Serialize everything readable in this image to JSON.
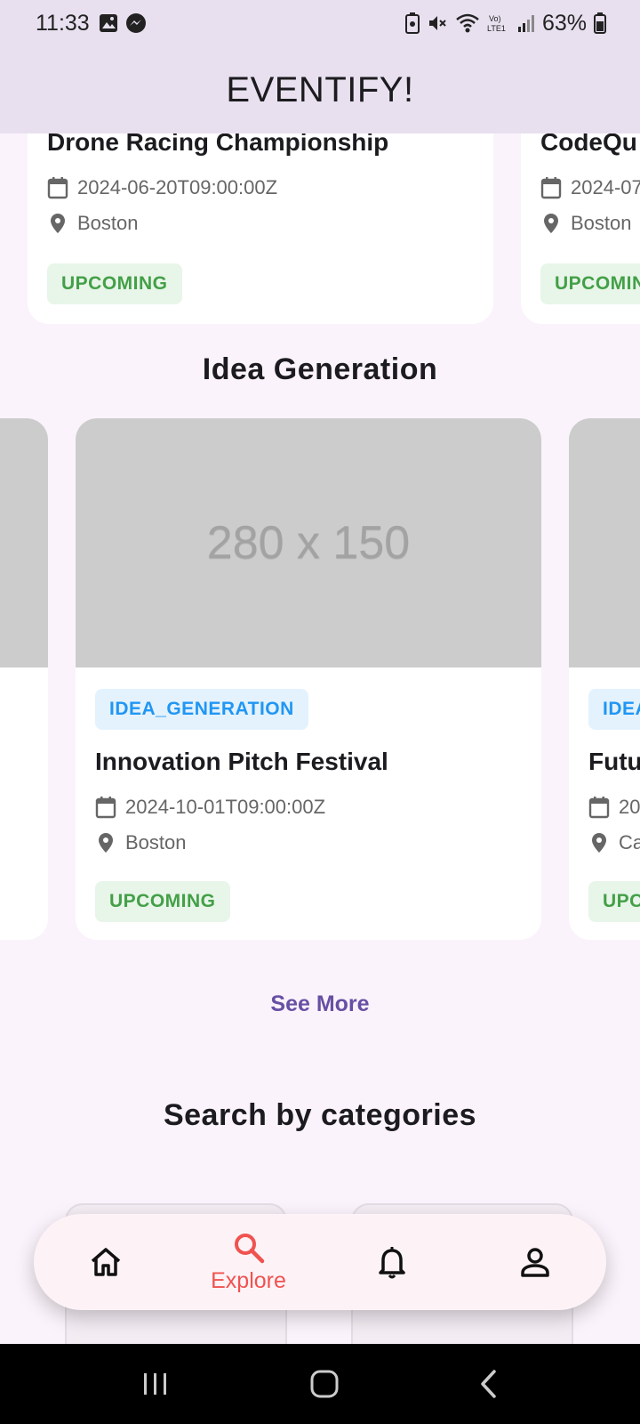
{
  "status_bar": {
    "time": "11:33",
    "battery": "63%"
  },
  "app_title": "EVENTIFY!",
  "top_cards": [
    {
      "title": "Drone Racing Championship",
      "date": "2024-06-20T09:00:00Z",
      "location": "Boston",
      "status": "UPCOMING"
    },
    {
      "title": "CodeQu",
      "date": "2024-07",
      "location": "Boston",
      "status": "UPCOMIN"
    }
  ],
  "idea_section": {
    "title": "Idea Generation",
    "cards": [
      {
        "image_text": "280 x 150",
        "category": "IDEA_GENERATION",
        "title": "Innovation Pitch Festival",
        "date": "2024-10-01T09:00:00Z",
        "location": "Boston",
        "status": "UPCOMING"
      },
      {
        "category": "IDEA",
        "title": "Futu",
        "date": "20",
        "location": "Ca",
        "status": "UPC"
      }
    ],
    "see_more": "See More"
  },
  "categories_section": {
    "title": "Search by categories"
  },
  "bottom_nav": {
    "items": [
      {
        "icon": "home-icon"
      },
      {
        "icon": "search-icon",
        "label": "Explore",
        "active": true
      },
      {
        "icon": "bell-icon"
      },
      {
        "icon": "person-icon"
      }
    ],
    "active_color": "#ef5350"
  },
  "colors": {
    "app_bar": "#e8e0ef",
    "background": "#fbf3fb",
    "category_chip": "#2196f3",
    "status_chip": "#43a047",
    "see_more": "#6750a4"
  }
}
